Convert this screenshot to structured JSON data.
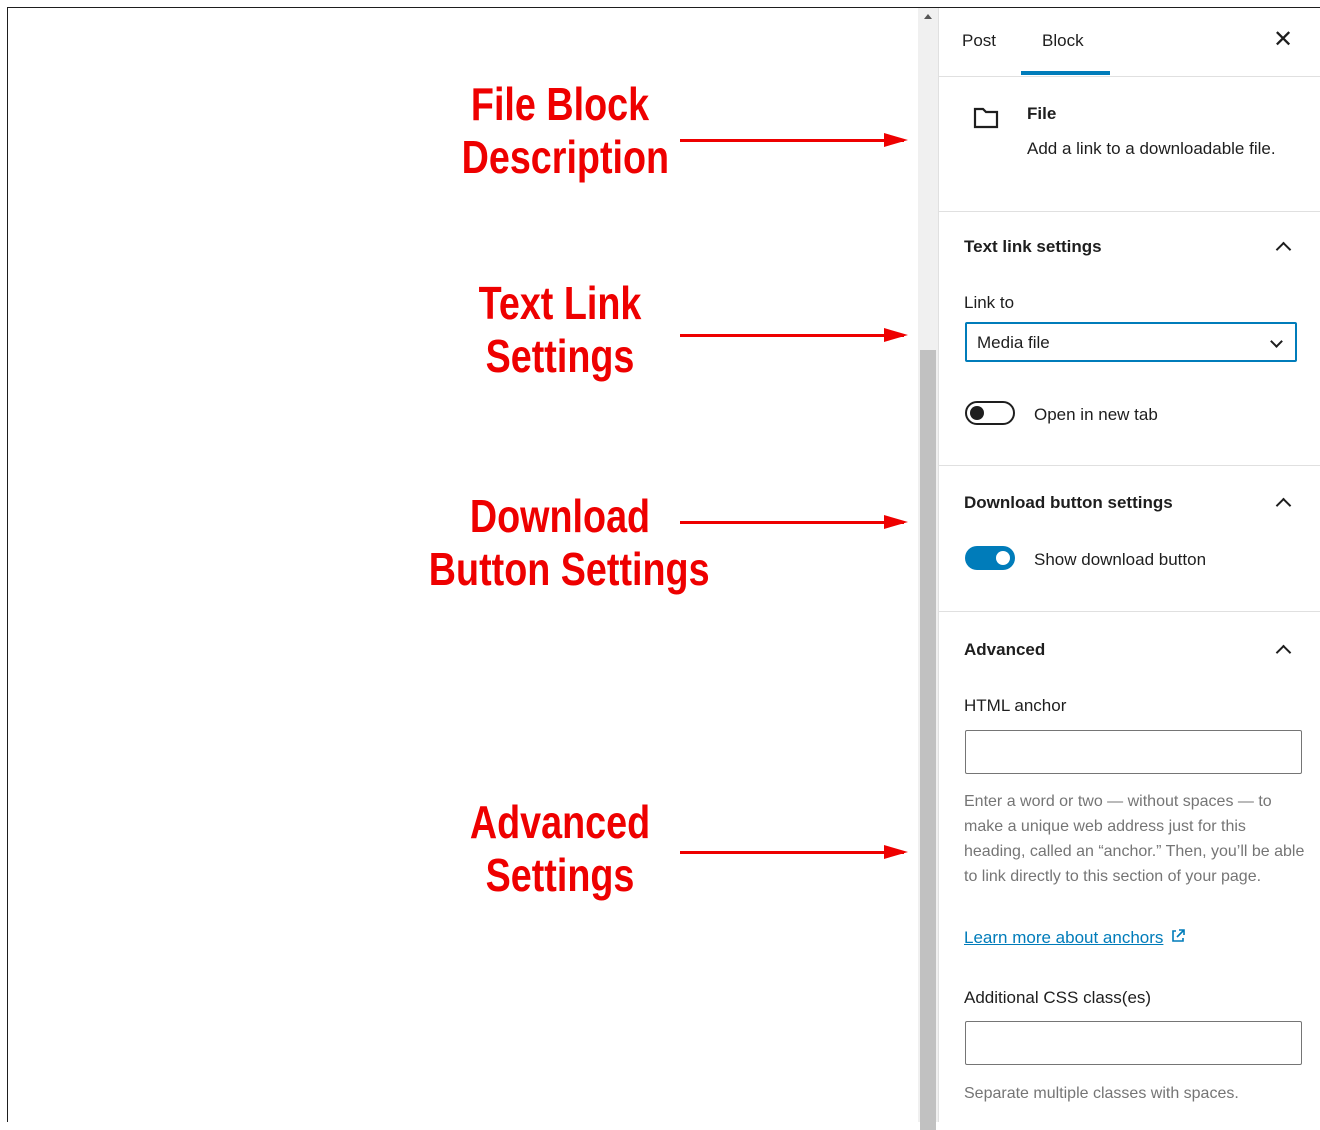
{
  "annotations": {
    "file_block": [
      "File Block",
      "Description"
    ],
    "text_link": [
      "Text Link",
      "Settings"
    ],
    "download": [
      "Download",
      "Button Settings"
    ],
    "advanced": [
      "Advanced",
      "Settings"
    ]
  },
  "sidebar": {
    "tabs": [
      {
        "label": "Post",
        "active": false
      },
      {
        "label": "Block",
        "active": true
      }
    ],
    "close_icon": "close-icon",
    "block": {
      "icon": "folder-icon",
      "title": "File",
      "description": "Add a link to a downloadable file."
    },
    "text_link_settings": {
      "title": "Text link settings",
      "link_to_label": "Link to",
      "link_to_value": "Media file",
      "open_new_tab_label": "Open in new tab",
      "open_new_tab_on": false
    },
    "download_button_settings": {
      "title": "Download button settings",
      "show_download_label": "Show download button",
      "show_download_on": true
    },
    "advanced": {
      "title": "Advanced",
      "html_anchor_label": "HTML anchor",
      "html_anchor_value": "",
      "html_anchor_help": "Enter a word or two — without spaces — to make a unique web address just for this heading, called an “anchor.” Then, you’ll be able to link directly to this section of your page.",
      "learn_more_link": "Learn more about anchors",
      "css_class_label": "Additional CSS class(es)",
      "css_class_value": "",
      "css_class_help": "Separate multiple classes with spaces."
    }
  },
  "colors": {
    "accent": "#007cba",
    "annotation": "#ee0000"
  }
}
